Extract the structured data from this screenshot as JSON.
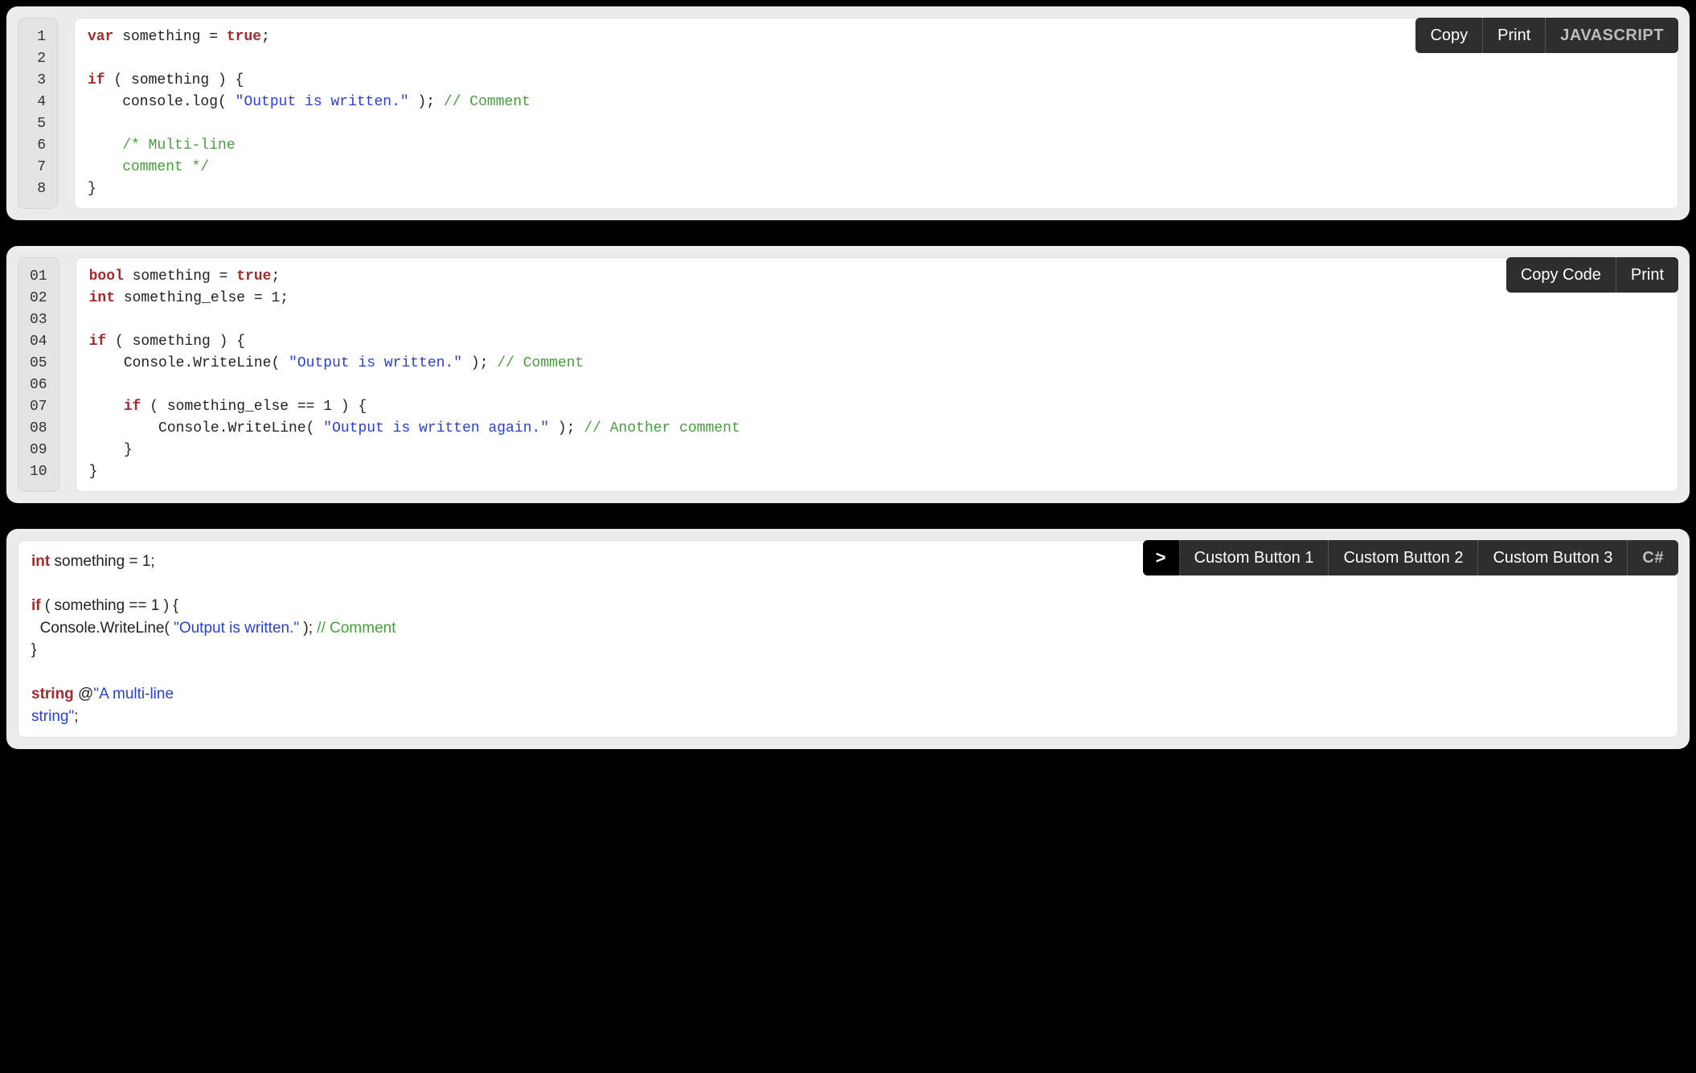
{
  "panel1": {
    "gutter": [
      "1",
      "2",
      "3",
      "4",
      "5",
      "6",
      "7",
      "8"
    ],
    "toolbar": {
      "copy": "Copy",
      "print": "Print",
      "lang": "JAVASCRIPT"
    },
    "tokens": [
      {
        "t": "var ",
        "c": "kw"
      },
      {
        "t": "something = "
      },
      {
        "t": "true",
        "c": "lit"
      },
      {
        "t": ";\n\n"
      },
      {
        "t": "if",
        "c": "kw"
      },
      {
        "t": " ( something ) {\n"
      },
      {
        "t": "    console.log( "
      },
      {
        "t": "\"Output is written.\"",
        "c": "str"
      },
      {
        "t": " ); "
      },
      {
        "t": "// Comment",
        "c": "cmt"
      },
      {
        "t": "\n\n"
      },
      {
        "t": "    "
      },
      {
        "t": "/* Multi-line\n    comment */",
        "c": "cmt"
      },
      {
        "t": "\n}"
      }
    ]
  },
  "panel2": {
    "gutter": [
      "01",
      "02",
      "03",
      "04",
      "05",
      "06",
      "07",
      "08",
      "09",
      "10"
    ],
    "toolbar": {
      "copy": "Copy Code",
      "print": "Print"
    },
    "tokens": [
      {
        "t": "bool ",
        "c": "kw"
      },
      {
        "t": "something = "
      },
      {
        "t": "true",
        "c": "lit"
      },
      {
        "t": ";\n"
      },
      {
        "t": "int ",
        "c": "kw"
      },
      {
        "t": "something_else = 1;\n\n"
      },
      {
        "t": "if",
        "c": "kw"
      },
      {
        "t": " ( something ) {\n"
      },
      {
        "t": "    Console.WriteLine( "
      },
      {
        "t": "\"Output is written.\"",
        "c": "str"
      },
      {
        "t": " ); "
      },
      {
        "t": "// Comment",
        "c": "cmt"
      },
      {
        "t": "\n\n"
      },
      {
        "t": "    "
      },
      {
        "t": "if",
        "c": "kw"
      },
      {
        "t": " ( something_else == 1 ) {\n"
      },
      {
        "t": "        Console.WriteLine( "
      },
      {
        "t": "\"Output is written again.\"",
        "c": "str"
      },
      {
        "t": " ); "
      },
      {
        "t": "// Another comment",
        "c": "cmt"
      },
      {
        "t": "\n"
      },
      {
        "t": "    }\n}"
      }
    ]
  },
  "panel3": {
    "toolbar": {
      "more": ">",
      "b1": "Custom Button 1",
      "b2": "Custom Button 2",
      "b3": "Custom Button 3",
      "lang": "C#"
    },
    "tokens": [
      {
        "t": "int",
        "c": "kw2"
      },
      {
        "t": " something = 1;\n\n"
      },
      {
        "t": "if",
        "c": "kw2"
      },
      {
        "t": " ( something == 1 ) {\n"
      },
      {
        "t": "  Console.WriteLine( "
      },
      {
        "t": "\"Output is written.\"",
        "c": "str"
      },
      {
        "t": " ); "
      },
      {
        "t": "// Comment",
        "c": "cmt"
      },
      {
        "t": "\n}\n\n"
      },
      {
        "t": "string",
        "c": "kw2"
      },
      {
        "t": " @"
      },
      {
        "t": "\"A multi-line\nstring\"",
        "c": "str"
      },
      {
        "t": ";"
      }
    ]
  }
}
